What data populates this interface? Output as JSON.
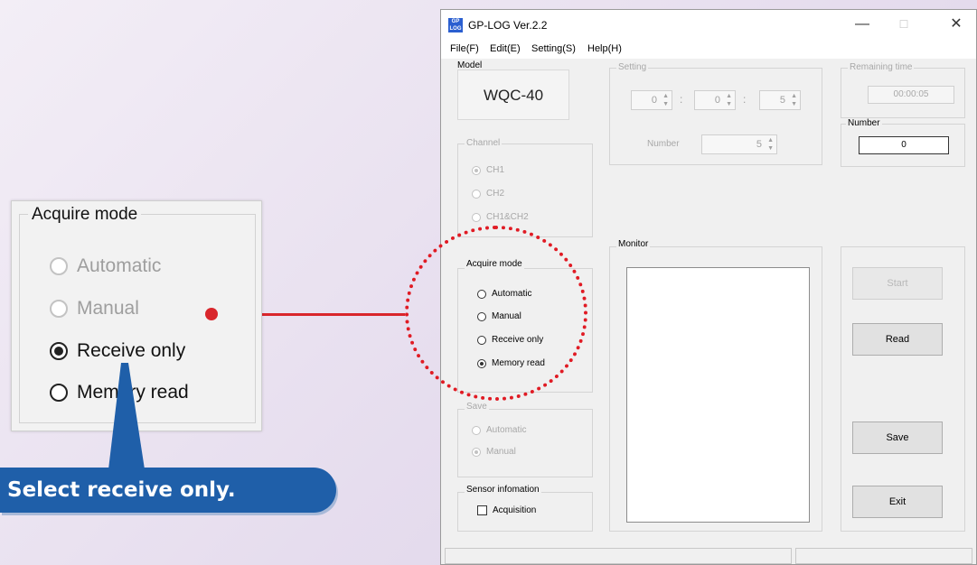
{
  "window": {
    "title": "GP-LOG Ver.2.2",
    "icon_text": "GP LOG",
    "controls": {
      "minimize": "—",
      "maximize": "☐",
      "close": "✕"
    }
  },
  "menu": [
    "File(F)",
    "Edit(E)",
    "Setting(S)",
    "Help(H)"
  ],
  "model": {
    "label": "Model",
    "value": "WQC-40"
  },
  "setting": {
    "label": "Setting",
    "time": [
      "0",
      "0",
      "5"
    ],
    "separator": ":",
    "number_label": "Number",
    "number_value": "5"
  },
  "remaining": {
    "label": "Remaining time",
    "value": "00:00:05"
  },
  "number_panel": {
    "label": "Number",
    "value": "0"
  },
  "channel": {
    "label": "Channel",
    "options": [
      {
        "label": "CH1",
        "checked": true
      },
      {
        "label": "CH2",
        "checked": false
      },
      {
        "label": "CH1&CH2",
        "checked": false
      }
    ]
  },
  "acquire_mode": {
    "label": "Acquire mode",
    "options": [
      {
        "label": "Automatic",
        "checked": false
      },
      {
        "label": "Manual",
        "checked": false
      },
      {
        "label": "Receive only",
        "checked": false
      },
      {
        "label": "Memory read",
        "checked": true
      }
    ]
  },
  "monitor": {
    "label": "Monitor"
  },
  "buttons": {
    "start": "Start",
    "read": "Read",
    "save": "Save",
    "exit": "Exit"
  },
  "save_group": {
    "label": "Save",
    "options": [
      {
        "label": "Automatic",
        "checked": false
      },
      {
        "label": "Manual",
        "checked": true
      }
    ]
  },
  "sensor": {
    "label": "Sensor infomation",
    "checkbox_label": "Acquisition",
    "checked": false
  },
  "zoom": {
    "label": "Acquire mode",
    "options": [
      {
        "label": "Automatic",
        "checked": false
      },
      {
        "label": "Manual",
        "checked": false
      },
      {
        "label": "Receive only",
        "checked": true
      },
      {
        "label": "Memory read",
        "checked": false
      }
    ]
  },
  "callout": {
    "text": "Select receive only."
  },
  "colors": {
    "highlight": "#e01b24",
    "banner": "#1f5fa9",
    "connector": "#d9262c"
  }
}
